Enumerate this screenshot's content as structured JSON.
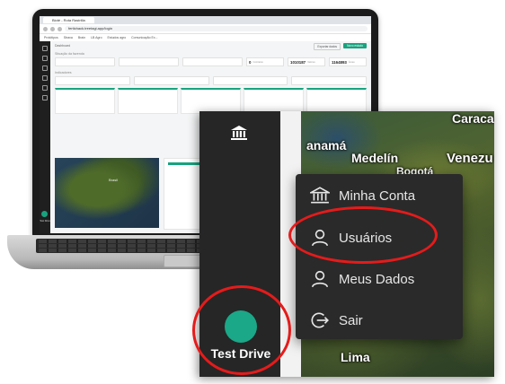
{
  "browser": {
    "tab_title": "Bioté - Rota Rastrilla",
    "url": "fertichack.treetagi.app/login",
    "bookmarks": [
      "Protótipos",
      "Strava",
      "Brain",
      "LB Agro",
      "Estudos agro",
      "Comunicação Ex..."
    ]
  },
  "app": {
    "breadcrumb": "Dashboard",
    "primary_button": "Novo estudo",
    "secondary_button": "Exportar dados",
    "section_area": "Situação da fazenda",
    "section_indicators": "Indicadores",
    "stats": [
      {
        "value": "0",
        "label": "Contratos"
      },
      {
        "value": "1010187",
        "label": "Valores"
      },
      {
        "value": "1164893",
        "label": "Áreas"
      }
    ],
    "map_label": "Brasil",
    "sidebar_user": "Test Drive"
  },
  "zoom": {
    "map_labels": [
      "Caraca",
      "anamá",
      "Medelín",
      "Venezu",
      "Bogotá",
      "Lima"
    ],
    "user_name": "Test Drive",
    "menu": [
      {
        "label": "Minha Conta",
        "icon": "bank-icon"
      },
      {
        "label": "Usuários",
        "icon": "user-icon"
      },
      {
        "label": "Meus Dados",
        "icon": "user-icon"
      },
      {
        "label": "Sair",
        "icon": "logout-icon"
      }
    ]
  },
  "colors": {
    "accent": "#1aa888",
    "sidebar": "#262626",
    "menu_bg": "#2a2a2a",
    "highlight_ring": "#e51b1b"
  }
}
